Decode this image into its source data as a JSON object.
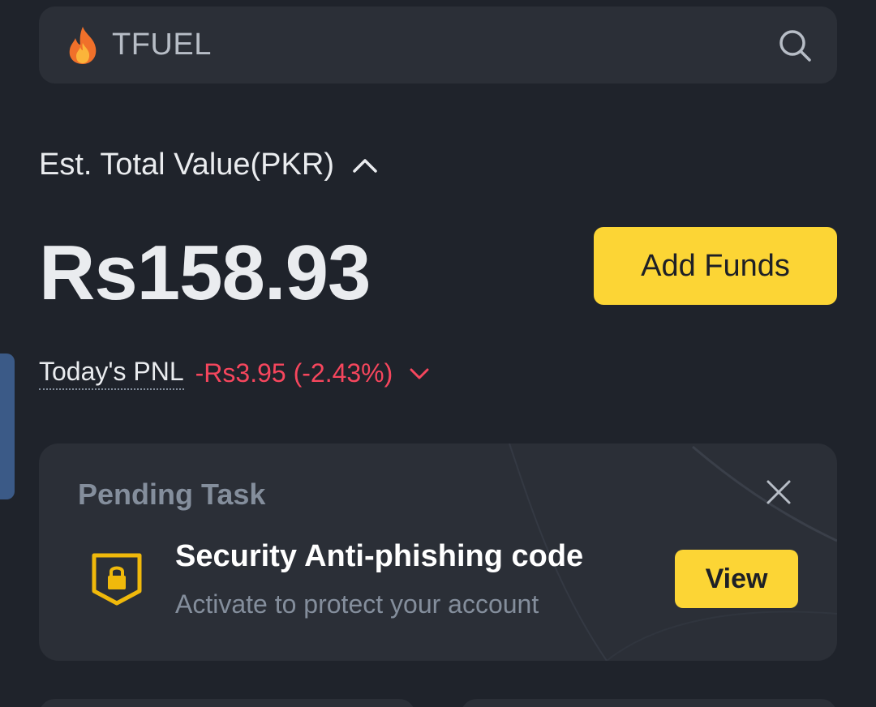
{
  "search": {
    "icon": "fire-icon",
    "query": "TFUEL"
  },
  "total": {
    "label": "Est. Total Value(PKR)",
    "value": "Rs158.93",
    "add_funds_label": "Add Funds"
  },
  "pnl": {
    "label": "Today's PNL",
    "value": "-Rs3.95 (-2.43%)",
    "color": "#f6465d"
  },
  "pending": {
    "title": "Pending Task",
    "task_title": "Security Anti-phishing code",
    "task_desc": "Activate to protect your account",
    "view_label": "View",
    "icon": "shield-lock-icon"
  },
  "colors": {
    "accent": "#fcd535",
    "background": "#1f232b",
    "card": "#2b2f37",
    "negative": "#f6465d"
  }
}
